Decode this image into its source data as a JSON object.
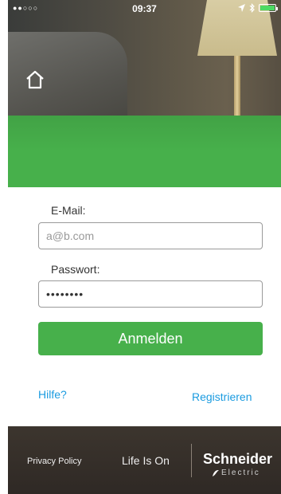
{
  "status_bar": {
    "signal": "●●○○○",
    "time": "09:37"
  },
  "form": {
    "email_label": "E-Mail:",
    "email_placeholder": "a@b.com",
    "password_label": "Passwort:",
    "password_value": "••••••••",
    "login_label": "Anmelden"
  },
  "links": {
    "help": "Hilfe?",
    "register": "Registrieren"
  },
  "footer": {
    "privacy": "Privacy Policy",
    "tagline": "Life Is On",
    "brand": "Schneider",
    "brand_sub": "Electric"
  },
  "colors": {
    "accent_green": "#47b04b",
    "link_blue": "#1a9be0",
    "footer_bg": "#3c352e"
  }
}
